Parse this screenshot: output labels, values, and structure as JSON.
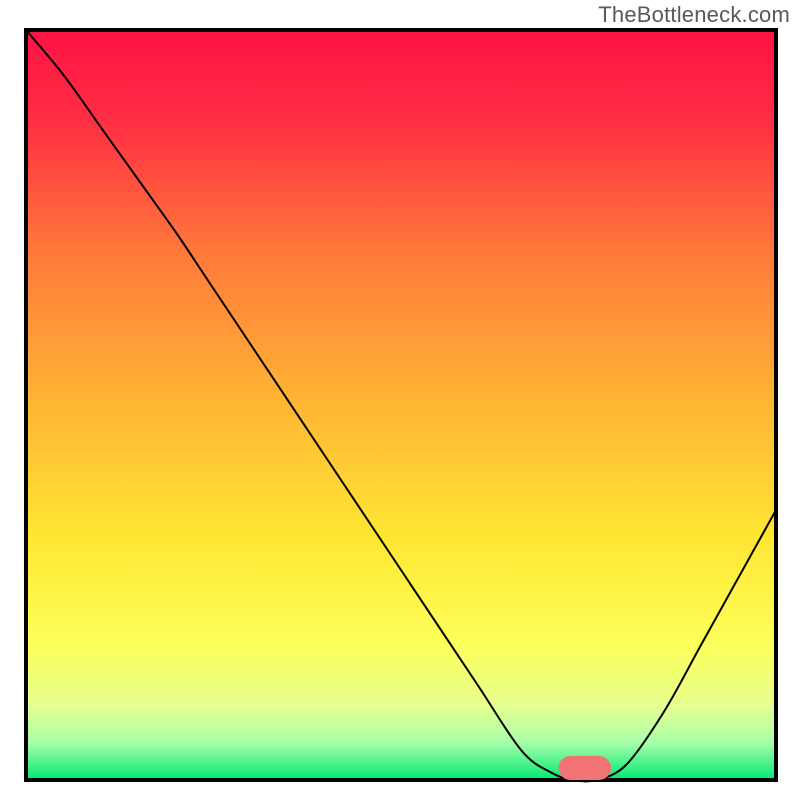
{
  "watermark": "TheBottleneck.com",
  "chart_data": {
    "type": "line",
    "title": "",
    "xlabel": "",
    "ylabel": "",
    "xlim": [
      0,
      100
    ],
    "ylim": [
      0,
      100
    ],
    "grid": false,
    "axes_visible": false,
    "background_gradient": {
      "type": "vertical",
      "stops": [
        {
          "pos": 0.0,
          "color": "#ff1244"
        },
        {
          "pos": 0.12,
          "color": "#ff2e43"
        },
        {
          "pos": 0.3,
          "color": "#ff7a3a"
        },
        {
          "pos": 0.5,
          "color": "#ffb634"
        },
        {
          "pos": 0.68,
          "color": "#ffe733"
        },
        {
          "pos": 0.82,
          "color": "#fdff5a"
        },
        {
          "pos": 0.9,
          "color": "#e6ff8e"
        },
        {
          "pos": 0.95,
          "color": "#a8ffaa"
        },
        {
          "pos": 1.0,
          "color": "#00e873"
        }
      ]
    },
    "series": [
      {
        "name": "bottleneck-curve",
        "color": "#000000",
        "stroke_width": 2,
        "x": [
          0,
          5,
          10,
          15,
          20,
          24,
          30,
          40,
          50,
          60,
          66,
          70,
          73,
          76,
          80,
          85,
          90,
          95,
          100
        ],
        "y": [
          100,
          94,
          87,
          80,
          73,
          67,
          58,
          43,
          28,
          13,
          4,
          1,
          0,
          0,
          2,
          9,
          18,
          27,
          36
        ]
      }
    ],
    "markers": [
      {
        "name": "optimal-marker",
        "type": "capsule",
        "color": "#f27373",
        "x_start": 71,
        "x_end": 78,
        "y": 0,
        "height": 3.2
      }
    ]
  }
}
